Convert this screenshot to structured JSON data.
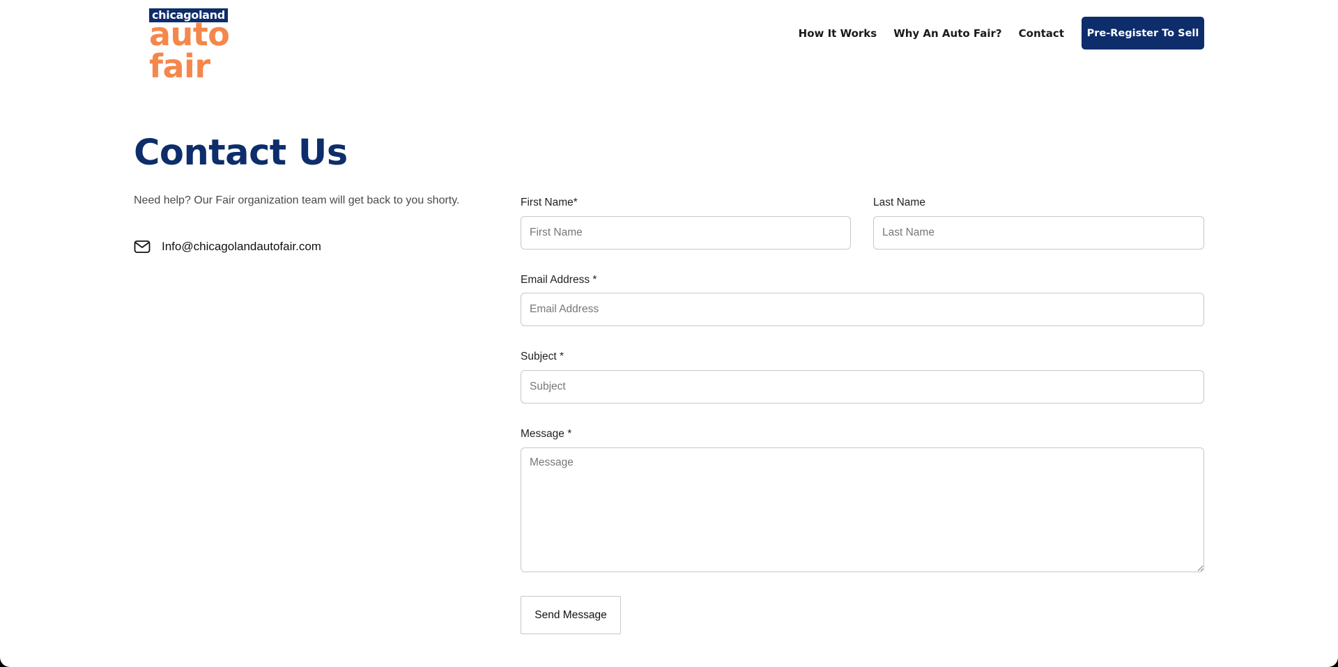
{
  "header": {
    "logo_top": "chicagoland",
    "logo_bottom": "auto fair",
    "nav": [
      {
        "label": "How It Works"
      },
      {
        "label": "Why An Auto Fair?"
      },
      {
        "label": "Contact"
      }
    ],
    "cta_label": "Pre-Register To Sell"
  },
  "contact": {
    "title": "Contact Us",
    "intro": "Need help? Our Fair organization team will get back to you shorty.",
    "email": "Info@chicagolandautofair.com",
    "email_icon": "mail-icon"
  },
  "form": {
    "first_name": {
      "label": "First Name*",
      "placeholder": "First Name",
      "value": ""
    },
    "last_name": {
      "label": "Last Name",
      "placeholder": "Last Name",
      "value": ""
    },
    "email": {
      "label": "Email Address *",
      "placeholder": "Email Address",
      "value": ""
    },
    "subject": {
      "label": "Subject *",
      "placeholder": "Subject",
      "value": ""
    },
    "message": {
      "label": "Message *",
      "placeholder": "Message",
      "value": ""
    },
    "submit_label": "Send Message"
  },
  "colors": {
    "brand_navy": "#0d2d6b",
    "brand_orange": "#f5874a"
  }
}
